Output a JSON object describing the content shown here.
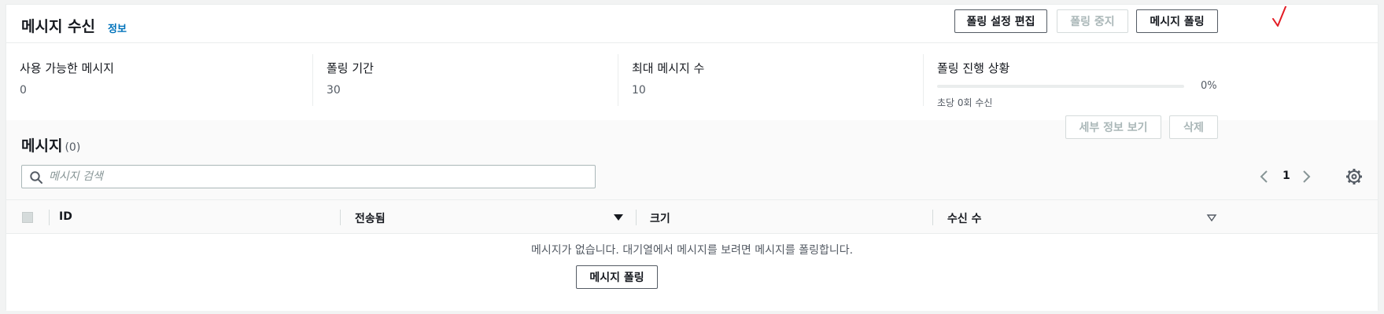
{
  "header": {
    "title": "메시지 수신",
    "info_link": "정보",
    "edit_polling_label": "폴링 설정 편집",
    "stop_polling_label": "폴링 중지",
    "poll_messages_label": "메시지 폴링"
  },
  "stats": {
    "available": {
      "label": "사용 가능한 메시지",
      "value": "0"
    },
    "duration": {
      "label": "폴링 기간",
      "value": "30"
    },
    "max_messages": {
      "label": "최대 메시지 수",
      "value": "10"
    },
    "progress": {
      "label": "폴링 진행 상황",
      "percent_text": "0%",
      "fraction": 0,
      "caption": "초당 0회 수신"
    }
  },
  "messages": {
    "title": "메시지",
    "count": "(0)",
    "view_details_label": "세부 정보 보기",
    "delete_label": "삭제",
    "search_placeholder": "메시지 검색",
    "search_value": "",
    "page": "1",
    "columns": [
      "ID",
      "전송됨",
      "크기",
      "수신 수"
    ],
    "empty_text": "메시지가 없습니다. 대기열에서 메시지를 보려면 메시지를 폴링합니다.",
    "empty_poll_label": "메시지 폴링"
  },
  "colors": {
    "accent": "#0073bb",
    "annotation_check": "#e31b23"
  },
  "icons": [
    "search-icon",
    "chevron-left-icon",
    "chevron-right-icon",
    "gear-icon",
    "sort-down-icon",
    "checkmark-icon"
  ]
}
